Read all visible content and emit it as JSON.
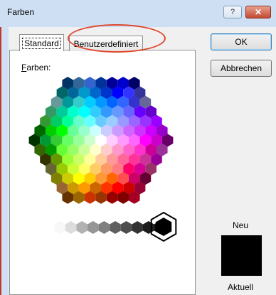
{
  "window": {
    "title": "Farben"
  },
  "titlebar": {
    "help_label": "?",
    "close_label": "✕"
  },
  "tabs": [
    {
      "label": "Standard",
      "active": true
    },
    {
      "label": "Benutzerdefiniert",
      "active": false
    }
  ],
  "palette_label": "Farben:",
  "buttons": {
    "ok": "OK",
    "cancel": "Abbrechen"
  },
  "preview": {
    "new_label": "Neu",
    "current_label": "Aktuell",
    "color": "#000000"
  },
  "annotation": {
    "color": "#e0462c"
  },
  "palette": {
    "rows": [
      [
        "#003366",
        "#336699",
        "#3366cc",
        "#003399",
        "#000099",
        "#0000cc",
        "#000066"
      ],
      [
        "#006666",
        "#006699",
        "#0099cc",
        "#0066cc",
        "#0033cc",
        "#0000ff",
        "#3333ff",
        "#333399"
      ],
      [
        "#669999",
        "#009999",
        "#33cccc",
        "#00ccff",
        "#0099ff",
        "#0066ff",
        "#3366ff",
        "#3333cc",
        "#666699"
      ],
      [
        "#339966",
        "#00cc99",
        "#00ffcc",
        "#00ffff",
        "#33ccff",
        "#3399ff",
        "#6699ff",
        "#6666ff",
        "#6600ff",
        "#6600cc"
      ],
      [
        "#339933",
        "#00cc66",
        "#00ff99",
        "#66ffcc",
        "#66ffff",
        "#66ccff",
        "#99ccff",
        "#9999ff",
        "#9966ff",
        "#9933ff",
        "#9900ff"
      ],
      [
        "#006600",
        "#00cc00",
        "#00ff00",
        "#66ff99",
        "#99ffcc",
        "#ccffff",
        "#ccccff",
        "#cc99ff",
        "#cc66ff",
        "#cc33ff",
        "#cc00ff",
        "#9900cc"
      ],
      [
        "#003300",
        "#009933",
        "#33cc33",
        "#66ff66",
        "#99ff99",
        "#ccffcc",
        "#ffffff",
        "#ffccff",
        "#ff99ff",
        "#ff66ff",
        "#ff00ff",
        "#cc00cc",
        "#660066"
      ],
      [
        "#336600",
        "#009900",
        "#66ff33",
        "#99ff66",
        "#ccff99",
        "#ffffcc",
        "#ffcccc",
        "#ff99cc",
        "#ff66cc",
        "#ff33cc",
        "#cc0099",
        "#993399"
      ],
      [
        "#333300",
        "#669900",
        "#99ff33",
        "#ccff66",
        "#ffff99",
        "#ffcc99",
        "#ff9999",
        "#ff6699",
        "#ff3399",
        "#cc3399",
        "#990099"
      ],
      [
        "#666633",
        "#99cc00",
        "#ccff33",
        "#ffff66",
        "#ffcc66",
        "#ff9966",
        "#ff7c80",
        "#ff0066",
        "#d60093",
        "#993366"
      ],
      [
        "#808000",
        "#cccc00",
        "#ffff00",
        "#ffcc00",
        "#ff9933",
        "#ff6600",
        "#ff5050",
        "#cc0066",
        "#660033"
      ],
      [
        "#996633",
        "#cc9900",
        "#ff9900",
        "#cc6600",
        "#ff3300",
        "#ff0000",
        "#cc0000",
        "#990033"
      ],
      [
        "#663300",
        "#996600",
        "#cc3300",
        "#993300",
        "#990000",
        "#800000",
        "#a50021"
      ]
    ],
    "grays": [
      "#f8f8f8",
      "#dddddd",
      "#b2b2b2",
      "#969696",
      "#808080",
      "#5f5f5f",
      "#4d4d4d",
      "#333333",
      "#1c1c1c",
      "#111111"
    ],
    "selected_gray": "#000000"
  }
}
